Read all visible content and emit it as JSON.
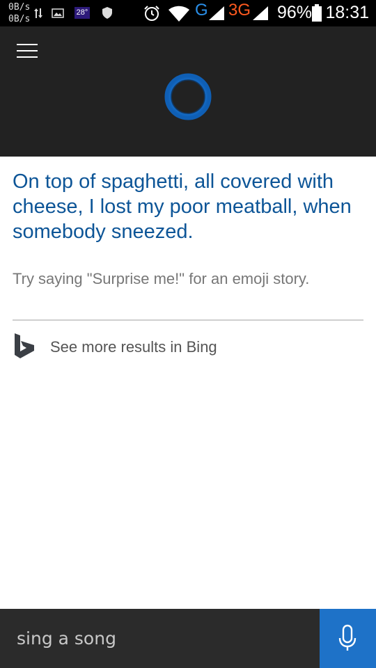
{
  "status_bar": {
    "net_up": "0B/s",
    "net_down": "0B/s",
    "temperature": "28°",
    "network_g": "G",
    "network_3g": "3G",
    "battery": "96%",
    "time": "18:31",
    "icons": [
      "data-arrows-icon",
      "image-icon",
      "shield-icon",
      "alarm-icon",
      "wifi-icon",
      "signal-icon",
      "signal-icon",
      "battery-icon"
    ]
  },
  "header": {
    "menu_icon": "hamburger-icon",
    "assistant_icon": "cortana-ring-icon",
    "accent_color": "#1a78d8"
  },
  "response": {
    "answer": "On top of spaghetti, all covered with cheese, I lost my poor meatball, when somebody sneezed.",
    "hint": "Try saying \"Surprise me!\" for an emoji story.",
    "answer_color": "#0d5597"
  },
  "bing": {
    "label": "See more results in Bing",
    "icon": "bing-logo-icon"
  },
  "query_bar": {
    "value": "sing a song",
    "mic_icon": "microphone-icon",
    "mic_color": "#1e72c8"
  }
}
